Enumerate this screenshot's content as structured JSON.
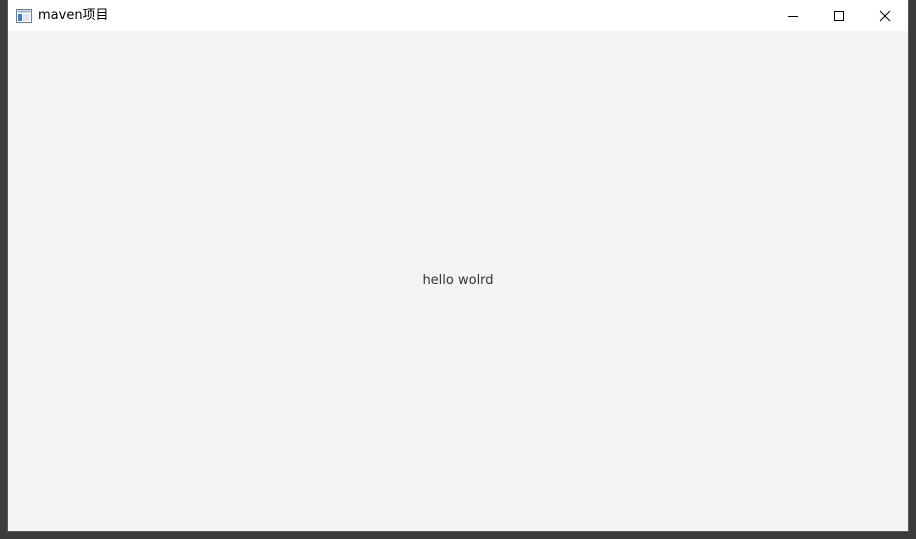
{
  "window": {
    "title": "maven项目",
    "app_icon": "window-app-icon",
    "controls": {
      "minimize_icon": "minimize-icon",
      "maximize_icon": "maximize-icon",
      "close_icon": "close-icon"
    }
  },
  "content": {
    "label": "hello wolrd"
  },
  "colors": {
    "titlebar": "#ffffff",
    "content_bg": "#f3f3f3",
    "desktop_bg": "#3b3b3b",
    "text": "#333333"
  }
}
